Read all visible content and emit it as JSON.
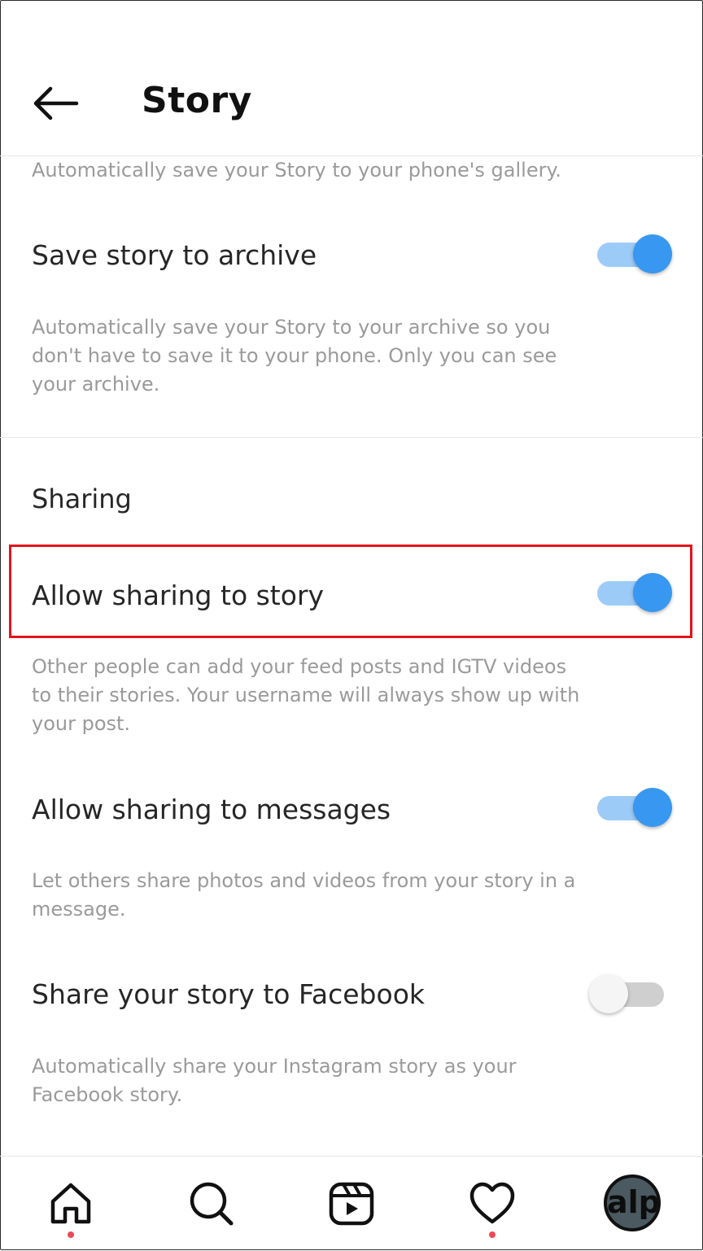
{
  "header": {
    "title": "Story"
  },
  "items": {
    "gallery_desc": "Automatically save your Story to your phone's gallery.",
    "archive": {
      "label": "Save story to archive",
      "desc": "Automatically save your Story to your archive so you don't have to save it to your phone. Only you can see your archive.",
      "on": true
    },
    "sharing_section": "Sharing",
    "share_story": {
      "label": "Allow sharing to story",
      "desc": "Other people can add your feed posts and IGTV videos to their stories. Your username will always show up with your post.",
      "on": true
    },
    "share_messages": {
      "label": "Allow sharing to messages",
      "desc": "Let others share photos and videos from your story in a message.",
      "on": true
    },
    "share_facebook": {
      "label": "Share your story to Facebook",
      "desc": "Automatically share your Instagram story as your Facebook story.",
      "on": false
    }
  },
  "nav": {
    "icons": [
      "home-icon",
      "search-icon",
      "reels-icon",
      "heart-icon",
      "avatar"
    ],
    "avatar_text": "alp"
  },
  "colors": {
    "accent": "#3897f0",
    "highlight": "#e3131b",
    "notification": "#ed4956"
  }
}
